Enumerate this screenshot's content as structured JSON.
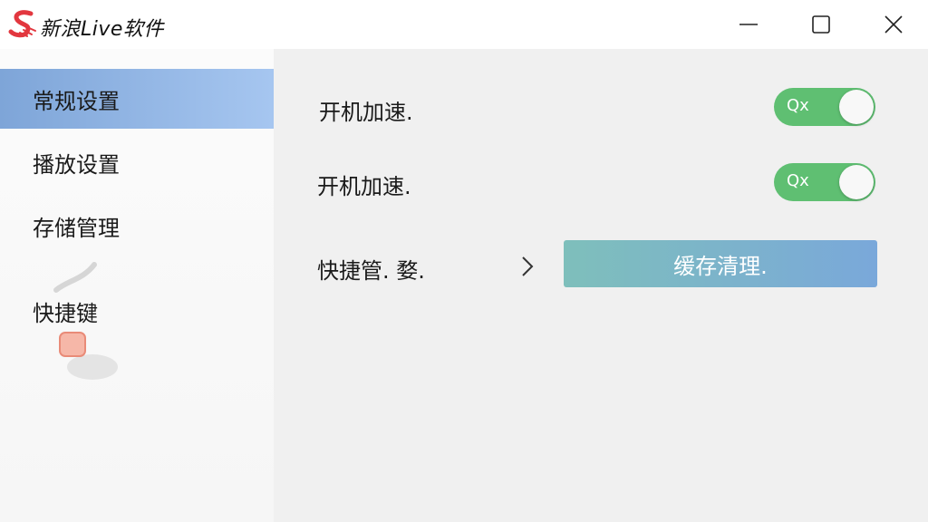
{
  "window": {
    "title": "新浪Live软件",
    "logo_icon": "sina-s-logo",
    "controls": [
      "minimize-icon",
      "maximize-icon",
      "close-icon"
    ]
  },
  "sidebar": {
    "items": [
      {
        "label": "常规设置",
        "active": true
      },
      {
        "label": "播放设置",
        "active": false
      },
      {
        "label": "存储管理",
        "active": false
      },
      {
        "label": "快捷键",
        "active": false
      }
    ],
    "active_color": "#94b8e6"
  },
  "main": {
    "rows": [
      {
        "label": "开机加速.",
        "toggle_text": "Qx",
        "toggle_on": true
      },
      {
        "label": "开机加速.",
        "toggle_text": "Qx",
        "toggle_on": true
      }
    ],
    "shortcut_row": {
      "label": "快捷管. 婺.",
      "button_label": "缓存清理."
    },
    "toggle_color": "#5fbf72",
    "logo_color": "#e2373f"
  }
}
